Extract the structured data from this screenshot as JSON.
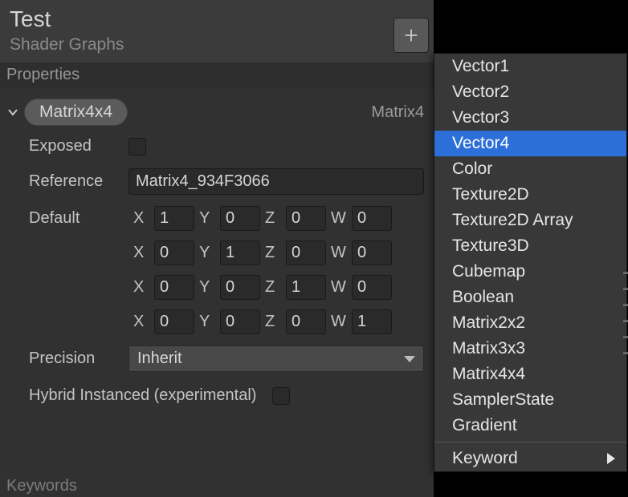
{
  "header": {
    "title": "Test",
    "subtitle": "Shader Graphs"
  },
  "section": {
    "properties_label": "Properties"
  },
  "property": {
    "chip": "Matrix4x4",
    "type_label": "Matrix4",
    "exposed_label": "Exposed",
    "reference_label": "Reference",
    "reference_value": "Matrix4_934F3066",
    "default_label": "Default",
    "axis_labels": {
      "x": "X",
      "y": "Y",
      "z": "Z",
      "w": "W"
    },
    "matrix": [
      [
        "1",
        "0",
        "0",
        "0"
      ],
      [
        "0",
        "1",
        "0",
        "0"
      ],
      [
        "0",
        "0",
        "1",
        "0"
      ],
      [
        "0",
        "0",
        "0",
        "1"
      ]
    ],
    "precision_label": "Precision",
    "precision_value": "Inherit",
    "hybrid_label": "Hybrid Instanced (experimental)"
  },
  "footer_hint": "Keywords",
  "menu": {
    "items": [
      "Vector1",
      "Vector2",
      "Vector3",
      "Vector4",
      "Color",
      "Texture2D",
      "Texture2D Array",
      "Texture3D",
      "Cubemap",
      "Boolean",
      "Matrix2x2",
      "Matrix3x3",
      "Matrix4x4",
      "SamplerState",
      "Gradient"
    ],
    "selected_index": 3,
    "submenu_label": "Keyword"
  }
}
